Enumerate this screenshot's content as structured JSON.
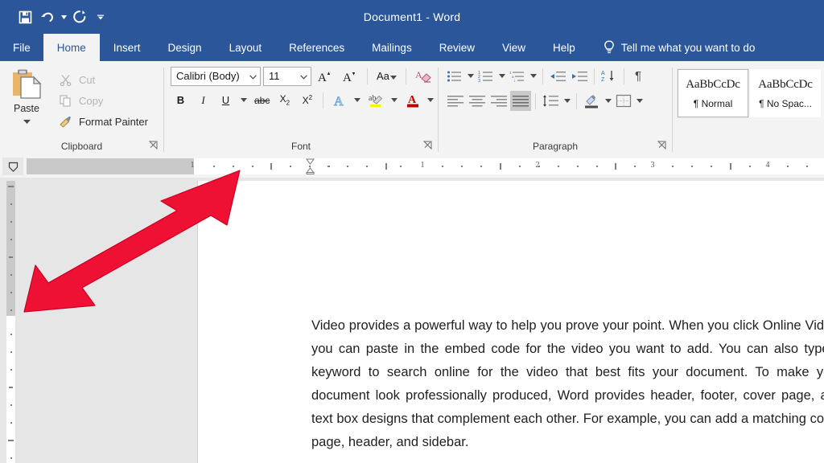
{
  "app": {
    "title": "Document1  -  Word",
    "accent_color": "#2b579a",
    "ribbon_bg": "#f3f3f3",
    "workspace_bg": "#e6e6e6",
    "annotation_color": "#ee1133"
  },
  "quick_access": {
    "items": [
      {
        "name": "save-icon",
        "label": "Save"
      },
      {
        "name": "undo-icon",
        "label": "Undo"
      },
      {
        "name": "redo-icon",
        "label": "Redo"
      },
      {
        "name": "customize-quick-access-icon",
        "label": "Customize Quick Access Toolbar"
      }
    ]
  },
  "tabs": [
    {
      "label": "File",
      "active": false
    },
    {
      "label": "Home",
      "active": true
    },
    {
      "label": "Insert",
      "active": false
    },
    {
      "label": "Design",
      "active": false
    },
    {
      "label": "Layout",
      "active": false
    },
    {
      "label": "References",
      "active": false
    },
    {
      "label": "Mailings",
      "active": false
    },
    {
      "label": "Review",
      "active": false
    },
    {
      "label": "View",
      "active": false
    },
    {
      "label": "Help",
      "active": false
    }
  ],
  "tell_me": {
    "label": "Tell me what you want to do",
    "icon": "lightbulb-icon"
  },
  "ribbon": {
    "clipboard": {
      "group_label": "Clipboard",
      "paste_label": "Paste",
      "items": [
        {
          "label": "Cut",
          "icon": "scissors-icon",
          "enabled": false
        },
        {
          "label": "Copy",
          "icon": "copy-icon",
          "enabled": false
        },
        {
          "label": "Format Painter",
          "icon": "paintbrush-icon",
          "enabled": true
        }
      ]
    },
    "font": {
      "group_label": "Font",
      "font_name": "Calibri (Body)",
      "font_size": "11",
      "buttons_row1": [
        {
          "label": "A",
          "name": "grow-font-button"
        },
        {
          "label": "A",
          "name": "shrink-font-button"
        },
        {
          "label": "Aa",
          "name": "change-case-button"
        },
        {
          "label": "",
          "name": "clear-formatting-icon"
        }
      ],
      "buttons_row2": [
        {
          "label": "B",
          "name": "bold-button"
        },
        {
          "label": "I",
          "name": "italic-button"
        },
        {
          "label": "U",
          "name": "underline-button"
        },
        {
          "label": "abc",
          "name": "strikethrough-button"
        },
        {
          "label": "X",
          "name": "subscript-button"
        },
        {
          "label": "X",
          "name": "superscript-button"
        },
        {
          "label": "A",
          "name": "text-effects-button"
        },
        {
          "label": "ab",
          "name": "text-highlight-color-button"
        },
        {
          "label": "A",
          "name": "font-color-button"
        }
      ]
    },
    "paragraph": {
      "group_label": "Paragraph",
      "row1": [
        {
          "name": "bullets-button"
        },
        {
          "name": "numbering-button"
        },
        {
          "name": "multilevel-list-button"
        },
        {
          "name": "decrease-indent-button"
        },
        {
          "name": "increase-indent-button"
        },
        {
          "name": "sort-button"
        },
        {
          "name": "show-formatting-marks-button"
        }
      ],
      "row2": [
        {
          "name": "align-left-button",
          "selected": false
        },
        {
          "name": "align-center-button",
          "selected": false
        },
        {
          "name": "align-right-button",
          "selected": false
        },
        {
          "name": "justify-button",
          "selected": true
        },
        {
          "name": "line-spacing-button",
          "selected": false
        },
        {
          "name": "shading-button",
          "selected": false
        },
        {
          "name": "borders-button",
          "selected": false
        }
      ]
    },
    "styles": {
      "items": [
        {
          "preview": "AaBbCcDc",
          "name": "Normal",
          "mark": "¶",
          "selected": true
        },
        {
          "preview": "AaBbCcDc",
          "name": "No Spac...",
          "mark": "¶",
          "selected": false
        }
      ]
    }
  },
  "ruler": {
    "tab_stop_selector": "left-tab-stop",
    "horizontal_numbers": [
      "1",
      "1",
      "2",
      "3",
      "4"
    ],
    "units": "inches"
  },
  "document": {
    "paragraph": "Video provides a powerful way to help you prove your point. When you click Online Video, you can paste in the embed code for the video you want to add. You can also type a keyword to search online for the video that best fits your document. To make your document look professionally produced, Word provides header, footer, cover page, and text box designs that complement each other. For example, you can add a matching cover page, header, and sidebar.",
    "alignment": "justify",
    "font": "Calibri",
    "size": "11"
  },
  "annotation": {
    "type": "double-headed-arrow",
    "direction": "lower-left-to-upper-right",
    "color": "#ee1133"
  }
}
